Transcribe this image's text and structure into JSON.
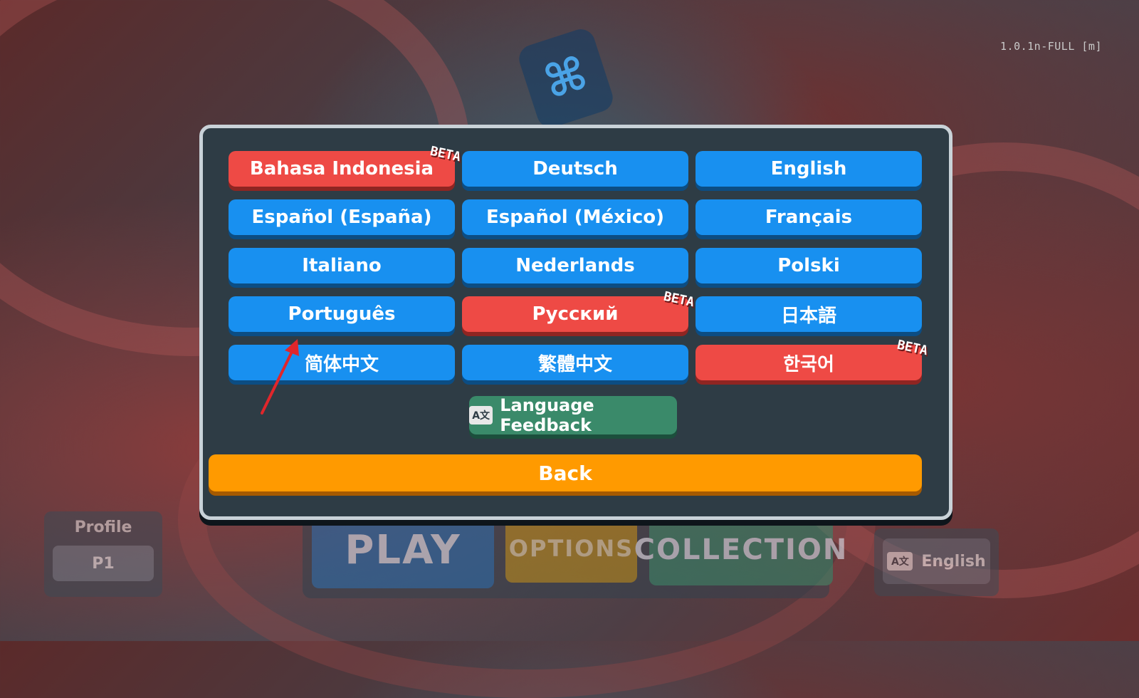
{
  "version": "1.0.1n-FULL [m]",
  "languages": [
    {
      "label": "Bahasa Indonesia",
      "beta": "BETA"
    },
    {
      "label": "Deutsch"
    },
    {
      "label": "English"
    },
    {
      "label": "Español (España)"
    },
    {
      "label": "Español (México)"
    },
    {
      "label": "Français"
    },
    {
      "label": "Italiano"
    },
    {
      "label": "Nederlands"
    },
    {
      "label": "Polski"
    },
    {
      "label": "Português"
    },
    {
      "label": "Русский",
      "beta": "BETA"
    },
    {
      "label": "日本語"
    },
    {
      "label": "简体中文"
    },
    {
      "label": "繁體中文"
    },
    {
      "label": "한국어",
      "beta": "BETA"
    }
  ],
  "feedback": {
    "label": "Language Feedback",
    "icon_text": "A文"
  },
  "back_label": "Back",
  "background_menu": {
    "profile_title": "Profile",
    "profile_value": "P1",
    "play_label": "PLAY",
    "options_label": "OPTIONS",
    "collection_label": "COLLECTION",
    "language_label": "English",
    "language_icon_text": "A文"
  },
  "colors": {
    "lang_blue": "#1890f0",
    "lang_beta_red": "#ee4a45",
    "feedback_green": "#3a8a6a",
    "back_orange": "#ff9a00"
  }
}
